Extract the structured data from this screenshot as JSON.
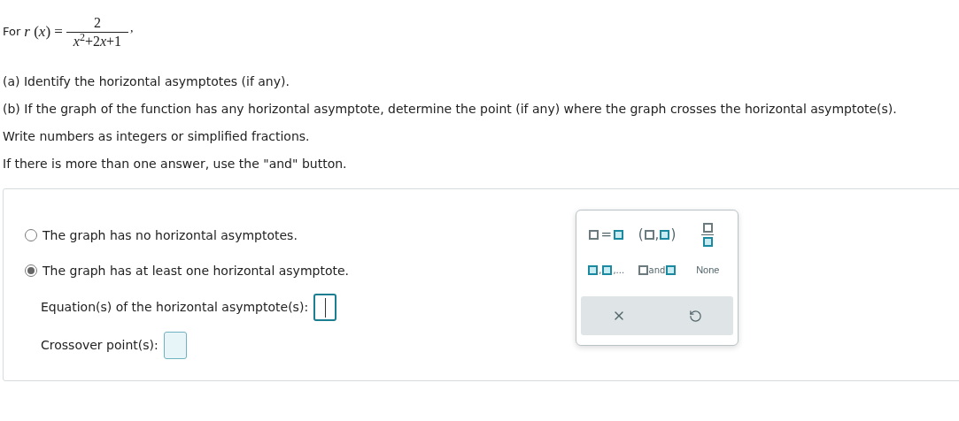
{
  "question": {
    "lead": "For",
    "lhs": "*r* (*x*) =",
    "numerator": "2",
    "denominator": [
      {
        "kind": "var",
        "text": "x"
      },
      {
        "kind": "sup",
        "text": "2"
      },
      {
        "kind": "num",
        "text": "+2"
      },
      {
        "kind": "var",
        "text": "x"
      },
      {
        "kind": "num",
        "text": "+1"
      }
    ],
    "trail": ","
  },
  "instructions": [
    "(a) Identify the horizontal asymptotes (if any).",
    "(b) If the graph of the function has any horizontal asymptote, determine the point (if any) where the graph crosses the horizontal asymptote(s).",
    "Write numbers as integers or simplified fractions.",
    "If there is more than one answer, use the \"and\" button."
  ],
  "options": [
    {
      "label": "The graph has no horizontal asymptotes.",
      "selected": false
    },
    {
      "label": "The graph has at least one horizontal asymptote.",
      "selected": true
    }
  ],
  "fields": [
    {
      "label": "Equation(s) of the horizontal asymptote(s):",
      "focused": true
    },
    {
      "label": "Crossover point(s):",
      "focused": false
    }
  ],
  "keypad": {
    "keys": [
      {
        "kind": "equation",
        "symbol": "="
      },
      {
        "kind": "point",
        "open": "(",
        "sep": ",",
        "close": ")"
      },
      {
        "kind": "fraction"
      },
      {
        "kind": "list",
        "sep": ",",
        "more": ",..."
      },
      {
        "kind": "and",
        "word": "and"
      },
      {
        "kind": "text",
        "label": "None"
      }
    ],
    "actions": [
      {
        "kind": "clear"
      },
      {
        "kind": "undo"
      }
    ]
  }
}
